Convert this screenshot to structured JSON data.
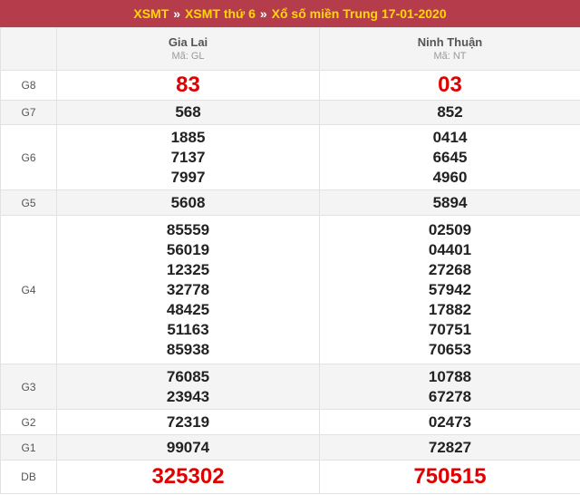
{
  "header": {
    "link_xsmt": "XSMT",
    "sep1": "»",
    "link_day": "XSMT thứ 6",
    "sep2": "»",
    "link_title": "Xổ số miền Trung 17-01-2020"
  },
  "provinces": [
    {
      "name": "Gia Lai",
      "code": "Mã: GL"
    },
    {
      "name": "Ninh Thuận",
      "code": "Mã: NT"
    }
  ],
  "prizes": {
    "g8": {
      "label": "G8",
      "p1": [
        "83"
      ],
      "p2": [
        "03"
      ]
    },
    "g7": {
      "label": "G7",
      "p1": [
        "568"
      ],
      "p2": [
        "852"
      ]
    },
    "g6": {
      "label": "G6",
      "p1": [
        "1885",
        "7137",
        "7997"
      ],
      "p2": [
        "0414",
        "6645",
        "4960"
      ]
    },
    "g5": {
      "label": "G5",
      "p1": [
        "5608"
      ],
      "p2": [
        "5894"
      ]
    },
    "g4": {
      "label": "G4",
      "p1": [
        "85559",
        "56019",
        "12325",
        "32778",
        "48425",
        "51163",
        "85938"
      ],
      "p2": [
        "02509",
        "04401",
        "27268",
        "57942",
        "17882",
        "70751",
        "70653"
      ]
    },
    "g3": {
      "label": "G3",
      "p1": [
        "76085",
        "23943"
      ],
      "p2": [
        "10788",
        "67278"
      ]
    },
    "g2": {
      "label": "G2",
      "p1": [
        "72319"
      ],
      "p2": [
        "02473"
      ]
    },
    "g1": {
      "label": "G1",
      "p1": [
        "99074"
      ],
      "p2": [
        "72827"
      ]
    },
    "db": {
      "label": "DB",
      "p1": [
        "325302"
      ],
      "p2": [
        "750515"
      ]
    }
  },
  "colors": {
    "header_bg": "#b53d4b",
    "header_link": "#ffd800",
    "highlight_number": "#e00000"
  }
}
